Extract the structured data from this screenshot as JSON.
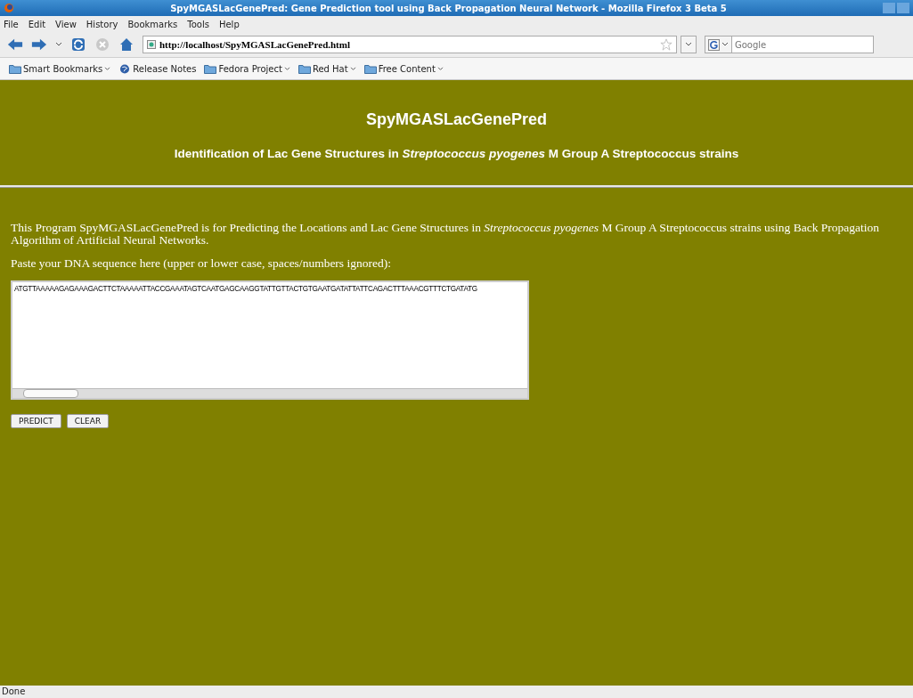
{
  "window": {
    "title": "SpyMGASLacGenePred: Gene Prediction tool using Back Propagation Neural Network - Mozilla Firefox 3 Beta 5"
  },
  "menu": [
    "File",
    "Edit",
    "View",
    "History",
    "Bookmarks",
    "Tools",
    "Help"
  ],
  "address_bar": {
    "value": "http://localhost/SpyMGASLacGenePred.html"
  },
  "search": {
    "placeholder": "Google"
  },
  "bookmarks": [
    {
      "label": "Smart Bookmarks",
      "kind": "folder"
    },
    {
      "label": "Release Notes",
      "kind": "link"
    },
    {
      "label": "Fedora Project",
      "kind": "folder"
    },
    {
      "label": "Red Hat",
      "kind": "folder"
    },
    {
      "label": "Free Content",
      "kind": "folder"
    }
  ],
  "page": {
    "title": "SpyMGASLacGenePred",
    "subtitle": "Identification of Lac Gene Structures in *Streptococcus pyogenes* M Group A Streptococcus strains",
    "description": "This Program SpyMGASLacGenePred is for Predicting the Locations and Lac Gene Structures in *Streptococcus pyogenes* M Group A Streptococcus strains using Back Propagation Algorithm of Artificial Neural Networks.",
    "prompt": "Paste your DNA sequence here (upper or lower case, spaces/numbers ignored):",
    "sequence": "ATGTTAAAAAGAGAAAGACTTCTAAAAATTACCGAAATAGTCAATGAGCAAGGTATTGTTACTGTGAATGATATTATTCAGACTTTAAACGTTTCTGATATG",
    "buttons": [
      "PREDICT",
      "CLEAR"
    ]
  },
  "status_bar": "Done"
}
